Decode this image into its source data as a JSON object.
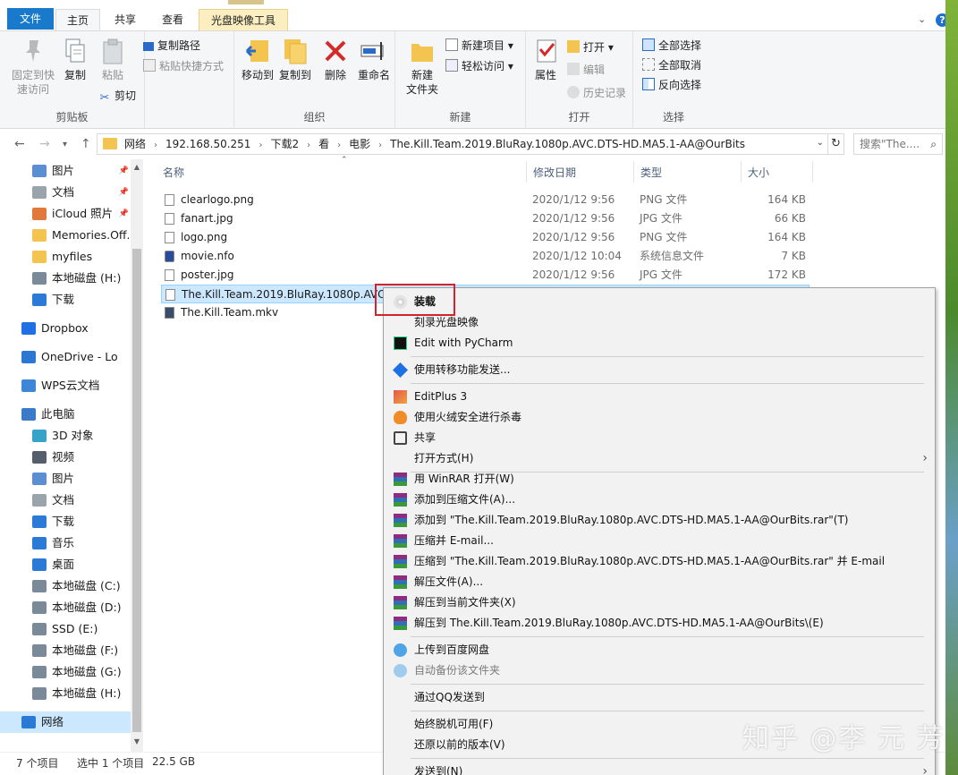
{
  "tabs": {
    "file": "文件",
    "home": "主页",
    "share": "共享",
    "view": "查看",
    "disk_tools": "光盘映像工具"
  },
  "ribbon": {
    "clipboard": {
      "name": "剪贴板",
      "pin_quick": "固定到快\n速访问",
      "copy": "复制",
      "paste": "粘贴",
      "copy_path": "复制路径",
      "paste_shortcut": "粘贴快捷方式",
      "cut": "剪切"
    },
    "organize": {
      "name": "组织",
      "move_to": "移动到",
      "copy_to": "复制到",
      "delete": "删除",
      "rename": "重命名"
    },
    "new": {
      "name": "新建",
      "new_folder": "新建\n文件夹",
      "new_item": "新建项目",
      "easy_access": "轻松访问"
    },
    "open": {
      "name": "打开",
      "properties": "属性",
      "open": "打开",
      "edit": "编辑",
      "history": "历史记录"
    },
    "select": {
      "name": "选择",
      "select_all": "全部选择",
      "select_none": "全部取消",
      "invert": "反向选择"
    }
  },
  "address": {
    "crumbs": [
      "网络",
      "192.168.50.251",
      "下载2",
      "看",
      "电影",
      "The.Kill.Team.2019.BluRay.1080p.AVC.DTS-HD.MA5.1-AA@OurBits"
    ],
    "search_placeholder": "搜索\"The...."
  },
  "sidebar": {
    "items": [
      {
        "label": "图片",
        "icon": "pictures-icon",
        "color": "#5b8fd1",
        "pinned": true
      },
      {
        "label": "文档",
        "icon": "documents-icon",
        "color": "#9aa4ad",
        "pinned": true
      },
      {
        "label": "iCloud 照片",
        "icon": "icloud-photos-icon",
        "color": "#e07a3c",
        "pinned": true
      },
      {
        "label": "Memories.Off.I",
        "icon": "folder-icon",
        "color": "#f3c44f",
        "pinned": false
      },
      {
        "label": "myfiles",
        "icon": "folder-icon",
        "color": "#f3c44f",
        "pinned": false
      },
      {
        "label": "本地磁盘 (H:)",
        "icon": "drive-icon",
        "color": "#7a8a99",
        "pinned": false
      },
      {
        "label": "下载",
        "icon": "downloads-icon",
        "color": "#2b7bd6",
        "pinned": false
      },
      {
        "label": "Dropbox",
        "icon": "dropbox-icon",
        "color": "#1f6fe5",
        "pinned": false
      },
      {
        "label": "OneDrive - Lo",
        "icon": "onedrive-icon",
        "color": "#2a78d4",
        "pinned": false
      },
      {
        "label": "WPS云文档",
        "icon": "wps-cloud-icon",
        "color": "#3e86d8",
        "pinned": false
      },
      {
        "label": "此电脑",
        "icon": "computer-icon",
        "color": "#3a7ac8",
        "pinned": false
      },
      {
        "label": "3D 对象",
        "icon": "3d-objects-icon",
        "color": "#37a3c9",
        "pinned": false
      },
      {
        "label": "视频",
        "icon": "videos-icon",
        "color": "#555f6b",
        "pinned": false
      },
      {
        "label": "图片",
        "icon": "pictures-icon",
        "color": "#5b8fd1",
        "pinned": false
      },
      {
        "label": "文档",
        "icon": "documents-icon",
        "color": "#9aa4ad",
        "pinned": false
      },
      {
        "label": "下载",
        "icon": "downloads-icon",
        "color": "#2b7bd6",
        "pinned": false
      },
      {
        "label": "音乐",
        "icon": "music-icon",
        "color": "#2b7bd6",
        "pinned": false
      },
      {
        "label": "桌面",
        "icon": "desktop-icon",
        "color": "#2b7bd6",
        "pinned": false
      },
      {
        "label": "本地磁盘 (C:)",
        "icon": "drive-icon",
        "color": "#7a8a99",
        "pinned": false
      },
      {
        "label": "本地磁盘 (D:)",
        "icon": "drive-icon",
        "color": "#7a8a99",
        "pinned": false
      },
      {
        "label": "SSD (E:)",
        "icon": "drive-icon",
        "color": "#7a8a99",
        "pinned": false
      },
      {
        "label": "本地磁盘 (F:)",
        "icon": "drive-icon",
        "color": "#7a8a99",
        "pinned": false
      },
      {
        "label": "本地磁盘 (G:)",
        "icon": "drive-icon",
        "color": "#7a8a99",
        "pinned": false
      },
      {
        "label": "本地磁盘 (H:)",
        "icon": "drive-icon",
        "color": "#7a8a99",
        "pinned": false
      },
      {
        "label": "网络",
        "icon": "network-icon",
        "color": "#2b7bd6",
        "pinned": false
      }
    ]
  },
  "columns": {
    "name": "名称",
    "date": "修改日期",
    "type": "类型",
    "size": "大小"
  },
  "files": [
    {
      "name": "clearlogo.png",
      "date": "2020/1/12 9:56",
      "type": "PNG 文件",
      "size": "164 KB"
    },
    {
      "name": "fanart.jpg",
      "date": "2020/1/12 9:56",
      "type": "JPG 文件",
      "size": "66 KB"
    },
    {
      "name": "logo.png",
      "date": "2020/1/12 9:56",
      "type": "PNG 文件",
      "size": "164 KB"
    },
    {
      "name": "movie.nfo",
      "date": "2020/1/12 10:04",
      "type": "系统信息文件",
      "size": "7 KB"
    },
    {
      "name": "poster.jpg",
      "date": "2020/1/12 9:56",
      "type": "JPG 文件",
      "size": "172 KB"
    },
    {
      "name": "The.Kill.Team.2019.BluRay.1080p.AVC.D",
      "date": "",
      "type": "",
      "size": ""
    },
    {
      "name": "The.Kill.Team.mkv",
      "date": "",
      "type": "",
      "size": ""
    }
  ],
  "status": {
    "count": "7 个项目",
    "selected": "选中 1 个项目",
    "size": "22.5 GB"
  },
  "context_menu": {
    "items": [
      {
        "label": "装载",
        "icon": "disc-icon",
        "bold": true
      },
      {
        "label": "刻录光盘映像",
        "icon": ""
      },
      {
        "label": "Edit with PyCharm",
        "icon": "pycharm-icon"
      },
      {
        "label": "使用转移功能发送...",
        "icon": "dropbox-icon"
      },
      {
        "label": "EditPlus 3",
        "icon": "editplus-icon"
      },
      {
        "label": "使用火绒安全进行杀毒",
        "icon": "huorong-icon"
      },
      {
        "label": "共享",
        "icon": "share-icon"
      },
      {
        "label": "打开方式(H)",
        "icon": "",
        "submenu": true
      },
      {
        "label": "用 WinRAR 打开(W)",
        "icon": "winrar-icon"
      },
      {
        "label": "添加到压缩文件(A)...",
        "icon": "winrar-icon"
      },
      {
        "label": "添加到 \"The.Kill.Team.2019.BluRay.1080p.AVC.DTS-HD.MA5.1-AA@OurBits.rar\"(T)",
        "icon": "winrar-icon"
      },
      {
        "label": "压缩并 E-mail...",
        "icon": "winrar-icon"
      },
      {
        "label": "压缩到 \"The.Kill.Team.2019.BluRay.1080p.AVC.DTS-HD.MA5.1-AA@OurBits.rar\" 并 E-mail",
        "icon": "winrar-icon"
      },
      {
        "label": "解压文件(A)...",
        "icon": "winrar-icon"
      },
      {
        "label": "解压到当前文件夹(X)",
        "icon": "winrar-icon"
      },
      {
        "label": "解压到 The.Kill.Team.2019.BluRay.1080p.AVC.DTS-HD.MA5.1-AA@OurBits\\(E)",
        "icon": "winrar-icon"
      },
      {
        "label": "上传到百度网盘",
        "icon": "baidu-netdisk-icon"
      },
      {
        "label": "自动备份该文件夹",
        "icon": "baidu-netdisk-icon",
        "disabled": true
      },
      {
        "label": "通过QQ发送到",
        "icon": ""
      },
      {
        "label": "始终脱机可用(F)",
        "icon": ""
      },
      {
        "label": "还原以前的版本(V)",
        "icon": ""
      },
      {
        "label": "发送到(N)",
        "icon": "",
        "submenu": true
      }
    ]
  },
  "watermark": "知乎 @李 元 芳",
  "colors": {
    "accent": "#1979ca",
    "selection": "#cce8ff",
    "highlight_box": "#d3242b"
  }
}
